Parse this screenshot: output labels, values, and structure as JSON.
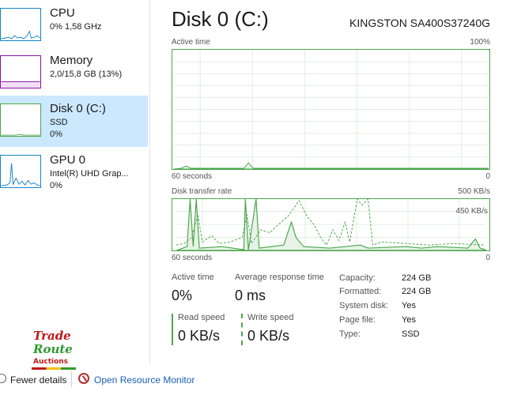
{
  "sidebar": {
    "items": [
      {
        "title": "CPU",
        "line1": "0% 1,58 GHz",
        "line2": "",
        "color": "#1783c8",
        "selected": false
      },
      {
        "title": "Memory",
        "line1": "2,0/15,8 GB (13%)",
        "line2": "",
        "color": "#8b12ae",
        "selected": false
      },
      {
        "title": "Disk 0 (C:)",
        "line1": "SSD",
        "line2": "0%",
        "color": "#4ca64c",
        "selected": true
      },
      {
        "title": "GPU 0",
        "line1": "Intel(R) UHD Grap...",
        "line2": "0%",
        "color": "#1783c8",
        "selected": false
      }
    ]
  },
  "header": {
    "title": "Disk 0 (C:)",
    "model": "KINGSTON SA400S37240G"
  },
  "active_chart": {
    "label": "Active time",
    "max": "100%",
    "time_span": "60 seconds",
    "min": "0"
  },
  "transfer_chart": {
    "label": "Disk transfer rate",
    "max": "500 KB/s",
    "inner_mark": "450 KB/s",
    "time_span": "60 seconds",
    "min": "0"
  },
  "stats": {
    "active_time_label": "Active time",
    "active_time_value": "0%",
    "response_label": "Average response time",
    "response_value": "0 ms",
    "read_label": "Read speed",
    "read_value": "0 KB/s",
    "write_label": "Write speed",
    "write_value": "0 KB/s"
  },
  "properties": [
    {
      "label": "Capacity:",
      "value": "224 GB"
    },
    {
      "label": "Formatted:",
      "value": "224 GB"
    },
    {
      "label": "System disk:",
      "value": "Yes"
    },
    {
      "label": "Page file:",
      "value": "Yes"
    },
    {
      "label": "Type:",
      "value": "SSD"
    }
  ],
  "footer": {
    "fewer_details": "Fewer details",
    "open_resource_monitor": "Open Resource Monitor"
  },
  "logo": {
    "line1": "Trade",
    "line2": "Route",
    "line3": "Auctions"
  },
  "colors": {
    "disk_green": "#4ca64c",
    "selected_bg": "#cce8ff",
    "link_blue": "#1a5fb4"
  }
}
